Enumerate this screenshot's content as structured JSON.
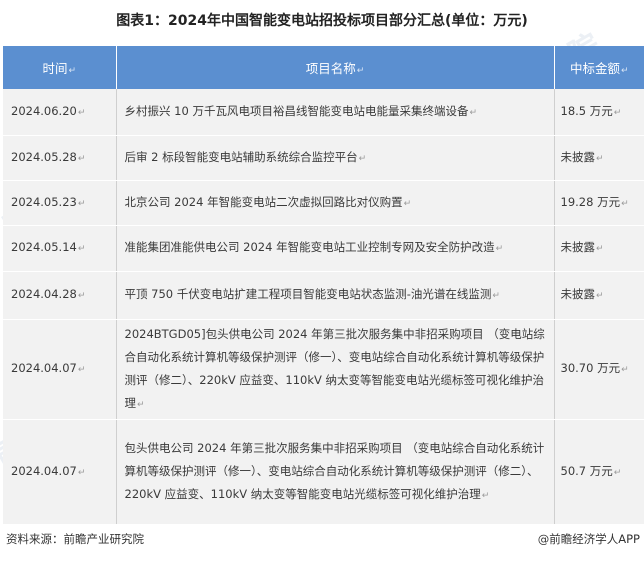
{
  "title": "图表1：2024年中国智能变电站招投标项目部分汇总(单位：万元)",
  "table": {
    "headers": [
      "时间",
      "项目名称",
      "中标金额"
    ],
    "rows": [
      {
        "time": "2024.06.20",
        "name": "乡村振兴 10 万千瓦风电项目裕昌线智能变电站电能量采集终端设备",
        "amount": "18.5 万元"
      },
      {
        "time": "2024.05.28",
        "name": "后审 2 标段智能变电站辅助系统综合监控平台",
        "amount": "未披露"
      },
      {
        "time": "2024.05.23",
        "name": "北京公司 2024 年智能变电站二次虚拟回路比对仪购置",
        "amount": "19.28 万元"
      },
      {
        "time": "2024.05.14",
        "name": "准能集团准能供电公司 2024 年智能变电站工业控制专网及安全防护改造",
        "amount": "未披露"
      },
      {
        "time": "2024.04.28",
        "name": "平顶 750 千伏变电站扩建工程项目智能变电站状态监测-油光谱在线监测",
        "amount": "未披露"
      },
      {
        "time": "2024.04.07",
        "name": "2024BTGD05]包头供电公司 2024 年第三批次服务集中非招采购项目 （变电站综合自动化系统计算机等级保护测评（修一）、变电站综合自动化系统计算机等级保护测评（修二）、220kV 应益变、110kV 纳太变等智能变电站光缆标签可视化维护治理",
        "amount": "30.70 万元"
      },
      {
        "time": "2024.04.07",
        "name": "包头供电公司 2024 年第三批次服务集中非招采购项目 （变电站综合自动化系统计算机等级保护测评（修一）、变电站综合自动化系统计算机等级保护测评（修二）、220kV 应益变、110kV 纳太变等智能变电站光缆标签可视化维护治理",
        "amount": "50.7 万元"
      }
    ],
    "cell_mark": "↵"
  },
  "footer": {
    "source": "资料来源：前瞻产业研究院",
    "brand": "@前瞻经济学人APP"
  },
  "watermark_text": "前瞻产业研究院",
  "colors": {
    "header_bg": "#5b8fd0",
    "row_bg": "#f2f2f2"
  }
}
